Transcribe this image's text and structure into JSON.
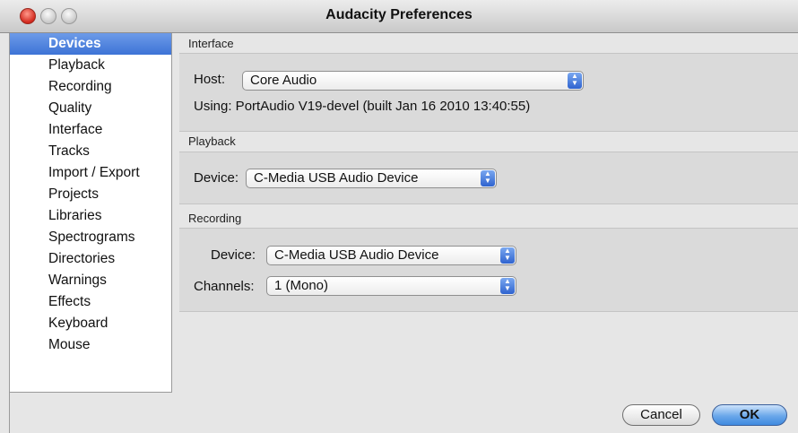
{
  "window": {
    "title": "Audacity Preferences"
  },
  "sidebar": {
    "items": [
      {
        "label": "Devices",
        "selected": true
      },
      {
        "label": "Playback"
      },
      {
        "label": "Recording"
      },
      {
        "label": "Quality"
      },
      {
        "label": "Interface"
      },
      {
        "label": "Tracks"
      },
      {
        "label": "Import / Export"
      },
      {
        "label": "Projects"
      },
      {
        "label": "Libraries"
      },
      {
        "label": "Spectrograms"
      },
      {
        "label": "Directories"
      },
      {
        "label": "Warnings"
      },
      {
        "label": "Effects"
      },
      {
        "label": "Keyboard"
      },
      {
        "label": "Mouse"
      }
    ]
  },
  "interface_section": {
    "label": "Interface",
    "host_label": "Host:",
    "host_value": "Core Audio",
    "using_text": "Using: PortAudio V19-devel (built Jan 16 2010 13:40:55)"
  },
  "playback_section": {
    "label": "Playback",
    "device_label": "Device:",
    "device_value": "C-Media USB Audio Device"
  },
  "recording_section": {
    "label": "Recording",
    "device_label": "Device:",
    "device_value": "C-Media USB Audio Device",
    "channels_label": "Channels:",
    "channels_value": "1 (Mono)"
  },
  "buttons": {
    "cancel": "Cancel",
    "ok": "OK"
  },
  "colors": {
    "selection": "#3d73d6",
    "ok_button": "#6aa7ea"
  }
}
